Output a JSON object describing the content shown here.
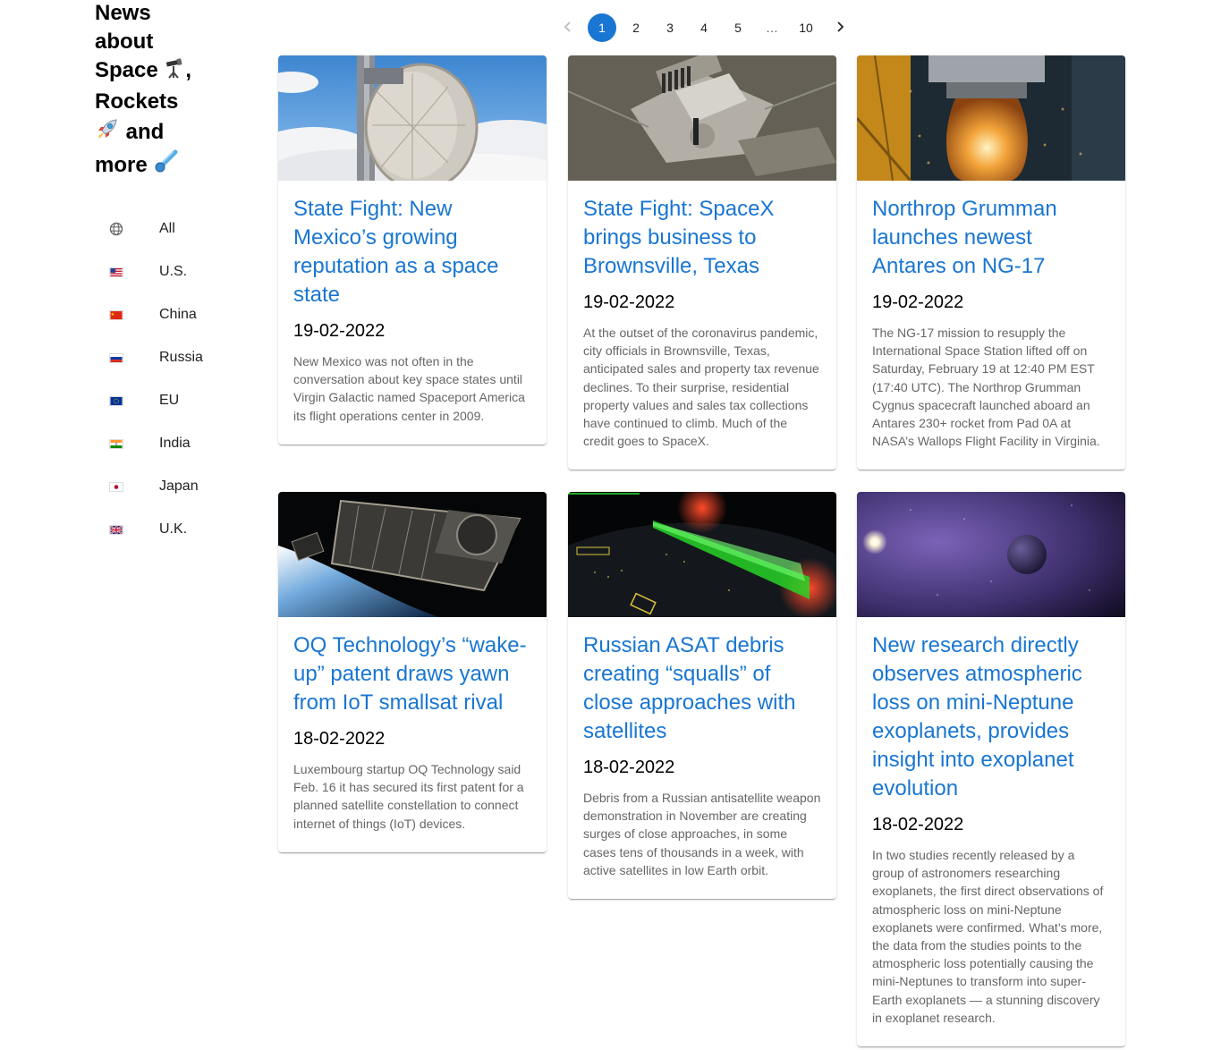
{
  "sidebar": {
    "title_parts": [
      "News about Space",
      ", Rockets",
      " and more"
    ],
    "title_icons": [
      "telescope-icon",
      "rocket-icon",
      "comet-icon"
    ],
    "items": [
      {
        "label": "All",
        "icon": "globe-icon"
      },
      {
        "label": "U.S.",
        "icon": "flag-us-icon"
      },
      {
        "label": "China",
        "icon": "flag-china-icon"
      },
      {
        "label": "Russia",
        "icon": "flag-russia-icon"
      },
      {
        "label": "EU",
        "icon": "flag-eu-icon"
      },
      {
        "label": "India",
        "icon": "flag-india-icon"
      },
      {
        "label": "Japan",
        "icon": "flag-japan-icon"
      },
      {
        "label": "U.K.",
        "icon": "flag-uk-icon"
      }
    ]
  },
  "pagination": {
    "current": "1",
    "pages": [
      "1",
      "2",
      "3",
      "4",
      "5"
    ],
    "ellipsis": "…",
    "last": "10",
    "prev_icon": "chevron-left-icon",
    "next_icon": "chevron-right-icon"
  },
  "colors": {
    "accent": "#1976d2",
    "text_muted": "#666666"
  },
  "articles": [
    {
      "title": "State Fight: New Mexico’s growing reputation as a space state",
      "date": "19-02-2022",
      "summary": "New Mexico was not often in the conversation about key space states until Virgin Galactic named Spaceport America its flight operations center in 2009.",
      "image": "antenna-dish-sky-image"
    },
    {
      "title": "State Fight: SpaceX brings business to Brownsville, Texas",
      "date": "19-02-2022",
      "summary": "At the outset of the coronavirus pandemic, city officials in Brownsville, Texas, anticipated sales and property tax revenue declines. To their surprise, residential property values and sales tax collections have continued to climb. Much of the credit goes to SpaceX.",
      "image": "aerial-launch-site-image"
    },
    {
      "title": "Northrop Grumman launches newest Antares on NG-17",
      "date": "19-02-2022",
      "summary": "The NG-17 mission to resupply the International Space Station lifted off on Saturday, February 19 at 12:40 PM EST (17:40 UTC). The Northrop Grumman Cygnus spacecraft launched aboard an Antares 230+ rocket from Pad 0A at NASA’s Wallops Flight Facility in Virginia.",
      "image": "rocket-engine-plume-image"
    },
    {
      "title": "OQ Technology’s “wake-up” patent draws yawn from IoT smallsat rival",
      "date": "18-02-2022",
      "summary": "Luxembourg startup OQ Technology said Feb. 16 it has secured its first patent for a planned satellite constellation to connect internet of things (IoT) devices.",
      "image": "cubesat-orbit-image"
    },
    {
      "title": "Russian ASAT debris creating “squalls” of close approaches with satellites",
      "date": "18-02-2022",
      "summary": "Debris from a Russian antisatellite weapon demonstration in November are creating surges of close approaches, in some cases tens of thousands in a week, with active satellites in low Earth orbit.",
      "image": "debris-visualization-image"
    },
    {
      "title": "New research directly observes atmospheric loss on mini-Neptune exoplanets, provides insight into exoplanet evolution",
      "date": "18-02-2022",
      "summary": "In two studies recently released by a group of astronomers researching exoplanets, the first direct observations of atmospheric loss on mini-Neptune exoplanets were confirmed. What’s more, the data from the studies points to the atmospheric loss potentially causing the mini-Neptunes to transform into super-Earth exoplanets — a stunning discovery in exoplanet research.",
      "image": "exoplanet-star-image"
    }
  ]
}
